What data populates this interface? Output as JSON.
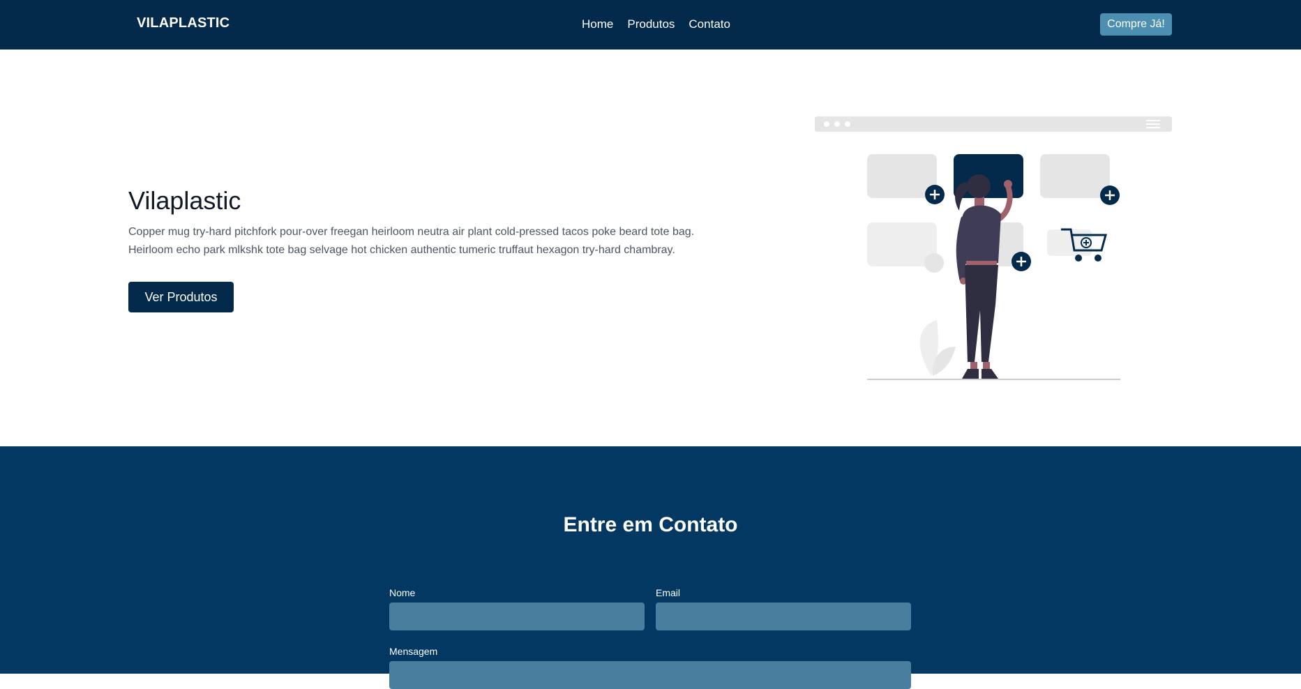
{
  "nav": {
    "brand": "VILAPLASTIC",
    "links": [
      "Home",
      "Produtos",
      "Contato"
    ],
    "cta": "Compre Já!"
  },
  "hero": {
    "title": "Vilaplastic",
    "description": "Copper mug try-hard pitchfork pour-over freegan heirloom neutra air plant cold-pressed tacos poke beard tote bag. Heirloom echo park mlkshk tote bag selvage hot chicken authentic tumeric truffaut hexagon try-hard chambray.",
    "button": "Ver Produtos"
  },
  "contact": {
    "title": "Entre em Contato",
    "name_label": "Nome",
    "email_label": "Email",
    "message_label": "Mensagem",
    "name_value": "",
    "email_value": "",
    "message_value": ""
  },
  "colors": {
    "nav_bg": "#03294b",
    "accent": "#4d8fb1",
    "contact_bg": "#023862",
    "input_bg": "#4a7e9e"
  },
  "icons": [
    "plus-icon",
    "shopping-cart-icon",
    "menu-icon"
  ]
}
